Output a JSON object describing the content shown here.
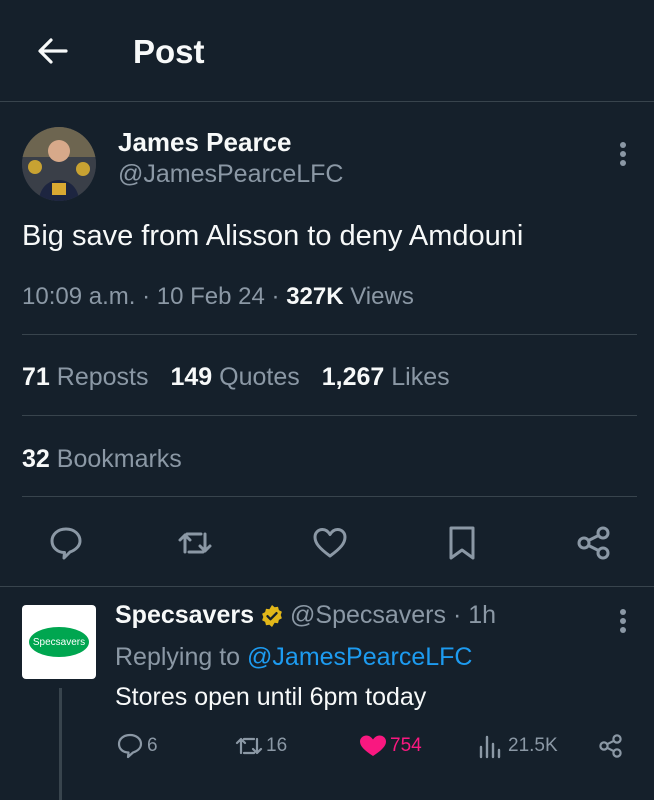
{
  "header": {
    "title": "Post"
  },
  "post": {
    "author_name": "James Pearce",
    "author_handle": "@JamesPearceLFC",
    "text": "Big save from Alisson to deny Amdouni",
    "time": "10:09 a.m.",
    "date": "10 Feb 24",
    "views_count": "327K",
    "views_label": "Views",
    "reposts_count": "71",
    "reposts_label": "Reposts",
    "quotes_count": "149",
    "quotes_label": "Quotes",
    "likes_count": "1,267",
    "likes_label": "Likes",
    "bookmarks_count": "32",
    "bookmarks_label": "Bookmarks"
  },
  "reply": {
    "author_name": "Specsavers",
    "author_handle": "@Specsavers",
    "time_ago": "1h",
    "replying_prefix": "Replying to",
    "replying_to": "@JamesPearceLFC",
    "text": "Stores open until 6pm today",
    "logo_text": "Specsavers",
    "replies": "6",
    "reposts": "16",
    "likes": "754",
    "views": "21.5K"
  },
  "colors": {
    "background": "#15202b",
    "text": "#f7f9f9",
    "muted": "#8b98a5",
    "link": "#1d9bf0",
    "like": "#f91880",
    "divider": "#38444d",
    "verified": "#e2b719"
  }
}
